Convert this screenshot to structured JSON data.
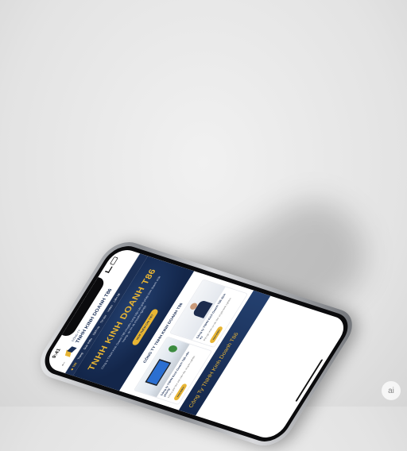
{
  "status": {
    "time": "9:41"
  },
  "header": {
    "brand_small": "CÔNG TY",
    "brand_big": "TNHH KINH DOANH T86"
  },
  "nav": {
    "logo_text": "T86",
    "items": [
      "Trang",
      "Giới thiệu",
      "Dịch vụ",
      "Tin tức",
      "Video",
      "Liên hệ"
    ]
  },
  "hero": {
    "title": "TNHH KINH DOANH T86",
    "description": "Công ty TNHH Kinh Doanh T86 chuyên cung cấp các giải pháp kinh doanh chất lượng, uy tín và chuyên nghiệp.",
    "button": "XEM THÊM CHI TIẾT"
  },
  "section": {
    "title": "CÔNG TY TNHH KINH DOANH T86",
    "cards": [
      {
        "title": "Công ty TNHH Kinh Doanh T86 văn phòng",
        "text": "Không gian làm việc hiện đại, chuyên nghiệp.",
        "button": "Xem thêm"
      },
      {
        "title": "Công ty TNHH Kinh Doanh T86 dịch vụ",
        "text": "Đội ngũ nhân sự tận tâm và giàu kinh nghiệm.",
        "button": "Xem thêm"
      }
    ]
  },
  "footer_banner": {
    "text": "Công Ty TNHH Kinh Doanh T86"
  },
  "badge": {
    "text": "ai"
  },
  "colors": {
    "navy": "#1b2f55",
    "gold": "#e8b533"
  }
}
